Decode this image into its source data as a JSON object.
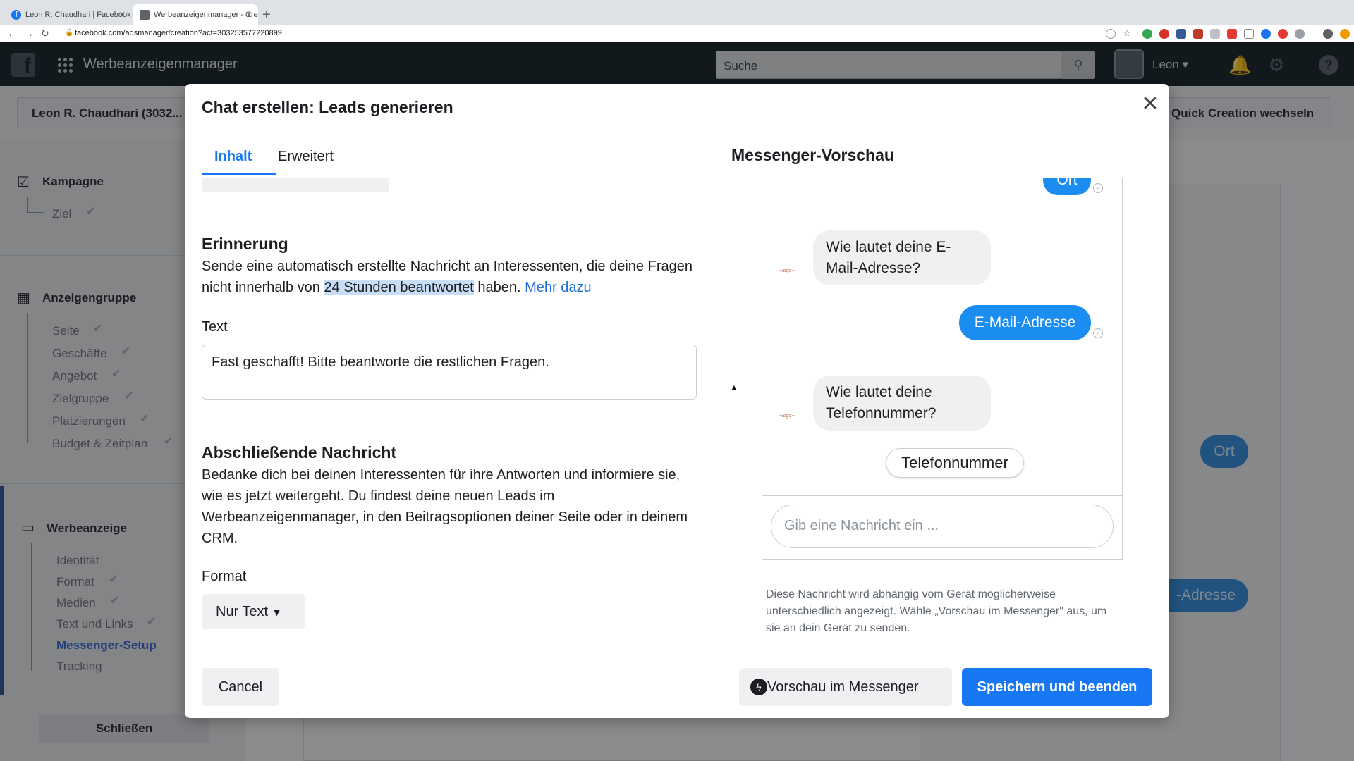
{
  "browser": {
    "tabs": [
      {
        "title": "Leon R. Chaudhari | Facebook"
      },
      {
        "title": "Werbeanzeigenmanager - Cre"
      }
    ],
    "url": "facebook.com/adsmanager/creation?act=303253577220899"
  },
  "header": {
    "app_title": "Werbeanzeigenmanager",
    "search_placeholder": "Suche",
    "user_name": "Leon"
  },
  "subheader": {
    "account": "Leon R. Chaudhari (3032...",
    "quick_creation": "Quick Creation wechseln"
  },
  "sidebar": {
    "sections": [
      {
        "title": "Kampagne",
        "items": [
          "Ziel"
        ]
      },
      {
        "title": "Anzeigengruppe",
        "items": [
          "Seite",
          "Geschäfte",
          "Angebot",
          "Zielgruppe",
          "Platzierungen",
          "Budget & Zeitplan"
        ]
      },
      {
        "title": "Werbeanzeige",
        "items": [
          "Identität",
          "Format",
          "Medien",
          "Text und Links",
          "Messenger-Setup",
          "Tracking"
        ]
      }
    ],
    "active_item": "Messenger-Setup",
    "close_label": "Schließen"
  },
  "background": {
    "bubble1": "Ort",
    "bubble2": "-Adresse"
  },
  "modal": {
    "title": "Chat erstellen: Leads generieren",
    "tabs": [
      "Inhalt",
      "Erweitert"
    ],
    "reminder": {
      "heading": "Erinnerung",
      "text_before": "Sende eine automatisch erstellte Nachricht an Interessenten, die deine Fragen nicht innerhalb von ",
      "text_highlight": "24 Stunden beantwortet",
      "text_after": " haben. ",
      "link": "Mehr dazu",
      "text_label": "Text",
      "text_value": "Fast geschafft! Bitte beantworte die restlichen Fragen."
    },
    "closing": {
      "heading": "Abschließende Nachricht",
      "text": "Bedanke dich bei deinen Interessenten für ihre Antworten und informiere sie, wie es jetzt weitergeht. Du findest deine neuen Leads im Werbeanzeigenmanager, in den Beitragsoptionen deiner Seite oder in deinem CRM.",
      "format_label": "Format",
      "format_value": "Nur Text"
    },
    "preview": {
      "title": "Messenger-Vorschau",
      "messages": [
        {
          "type": "out",
          "text": "Ort"
        },
        {
          "type": "in",
          "text": "Wie lautet deine E-Mail-Adresse?"
        },
        {
          "type": "out",
          "text": "E-Mail-Adresse"
        },
        {
          "type": "in",
          "text": "Wie lautet deine Telefonnummer?"
        }
      ],
      "quick_reply": "Telefonnummer",
      "composer_placeholder": "Gib eine Nachricht ein ...",
      "note": "Diese Nachricht wird abhängig vom Gerät möglicherweise unterschiedlich angezeigt. Wähle „Vorschau im Messenger\" aus, um sie an dein Gerät zu senden."
    },
    "buttons": {
      "cancel": "Cancel",
      "preview_messenger": "Vorschau im Messenger",
      "save": "Speichern und beenden"
    }
  },
  "colors": {
    "primary": "#1877f2",
    "bubble_out": "#1b8cf0",
    "header_bg": "#202b33"
  }
}
